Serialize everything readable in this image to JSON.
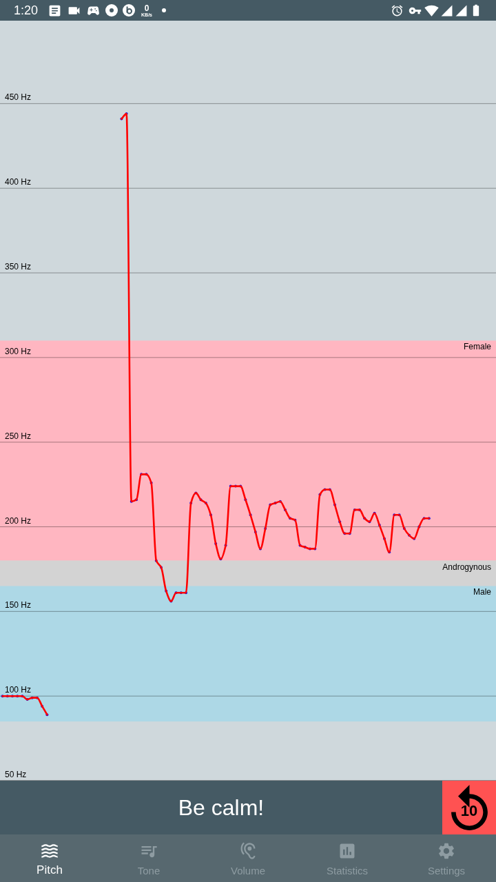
{
  "status_bar": {
    "time": "1:20",
    "net_speed": "0",
    "net_speed_unit": "KB/s"
  },
  "pitch_chart": {
    "chart_data": {
      "type": "line",
      "grid": true,
      "ylim": [
        50,
        499
      ],
      "yticks": [
        {
          "value": 50,
          "label": "50 Hz"
        },
        {
          "value": 100,
          "label": "100 Hz"
        },
        {
          "value": 150,
          "label": "150 Hz"
        },
        {
          "value": 200,
          "label": "200 Hz"
        },
        {
          "value": 250,
          "label": "250 Hz"
        },
        {
          "value": 300,
          "label": "300 Hz"
        },
        {
          "value": 350,
          "label": "350 Hz"
        },
        {
          "value": 400,
          "label": "400 Hz"
        },
        {
          "value": 450,
          "label": "450 Hz"
        }
      ],
      "categories": [
        null,
        null,
        null,
        null,
        null,
        null,
        null,
        null,
        null,
        null,
        null,
        null,
        null,
        null,
        null,
        null,
        null,
        null,
        null,
        null,
        null,
        null,
        null,
        null,
        null,
        null,
        null,
        null,
        null,
        null,
        null,
        null,
        null,
        null,
        null,
        null,
        null,
        null,
        null,
        null,
        null,
        null,
        null,
        null,
        null,
        null,
        null,
        null,
        null,
        null,
        null,
        null,
        null,
        null,
        null,
        null,
        null,
        null,
        null,
        null,
        null,
        null,
        null,
        null,
        null,
        null,
        null,
        null,
        null,
        null,
        null,
        null,
        null,
        null,
        null,
        null,
        null,
        null,
        null,
        null,
        null,
        null,
        null,
        null,
        null,
        null,
        null,
        null,
        null,
        null,
        null,
        null,
        null,
        null,
        null,
        null,
        null,
        null,
        null,
        null
      ],
      "series": [
        {
          "color": "#ff0000",
          "values": [
            100,
            100,
            100,
            100,
            100,
            98,
            99,
            99,
            94,
            89,
            null,
            null,
            null,
            null,
            null,
            null,
            null,
            null,
            null,
            null,
            null,
            null,
            null,
            null,
            null,
            null,
            null,
            null,
            null,
            null,
            null,
            null,
            null,
            null,
            null,
            null,
            null,
            null,
            null,
            null,
            null,
            null,
            null,
            null,
            null,
            null,
            null,
            null,
            null,
            null,
            null,
            null,
            null,
            null,
            null,
            null,
            null,
            null,
            null,
            null,
            null,
            null,
            null,
            null,
            null,
            null,
            null,
            null,
            null,
            null,
            null,
            null,
            null,
            null,
            null,
            null,
            null,
            null,
            null,
            null,
            null,
            null,
            null,
            null,
            null,
            null,
            null,
            null,
            null,
            null,
            null,
            null,
            null,
            null,
            null,
            null,
            null,
            null,
            null,
            null
          ]
        },
        {
          "color": "#ff0000",
          "values": [
            null,
            null,
            null,
            null,
            null,
            null,
            null,
            null,
            null,
            null,
            null,
            null,
            null,
            null,
            null,
            null,
            null,
            null,
            null,
            null,
            null,
            null,
            null,
            null,
            441,
            444,
            215,
            216,
            231,
            231,
            226,
            180,
            176,
            162,
            156,
            161,
            161,
            161,
            214,
            220,
            216,
            214,
            207,
            190,
            181,
            189,
            224,
            224,
            224,
            216,
            207,
            197,
            187,
            199,
            213,
            214,
            215,
            210,
            205,
            204,
            189,
            188,
            187,
            187,
            219,
            222,
            222,
            213,
            203,
            196,
            196,
            210,
            210,
            205,
            203,
            208,
            201,
            193,
            185,
            207,
            207,
            199,
            195,
            193,
            200,
            205,
            205,
            null,
            null,
            null,
            null,
            null,
            null,
            null,
            null,
            null,
            null,
            null,
            null,
            null
          ]
        }
      ],
      "bands": [
        {
          "axis": "y",
          "label": "Female",
          "from": 180,
          "to": 310,
          "color": "#ffb6c1"
        },
        {
          "axis": "y",
          "label": "Androgynous",
          "from": 165,
          "to": 180,
          "color": "#d3d3d3"
        },
        {
          "axis": "y",
          "label": "Male",
          "from": 85,
          "to": 165,
          "color": "#add8e6"
        }
      ]
    }
  },
  "feedback_bar": {
    "message": "Be calm!",
    "replay_button": {
      "label": "10"
    }
  },
  "bottom_nav": {
    "items": [
      {
        "label": "Pitch",
        "selected": true
      },
      {
        "label": "Tone",
        "selected": false
      },
      {
        "label": "Volume",
        "selected": false
      },
      {
        "label": "Statistics",
        "selected": false
      },
      {
        "label": "Settings",
        "selected": false
      }
    ]
  }
}
